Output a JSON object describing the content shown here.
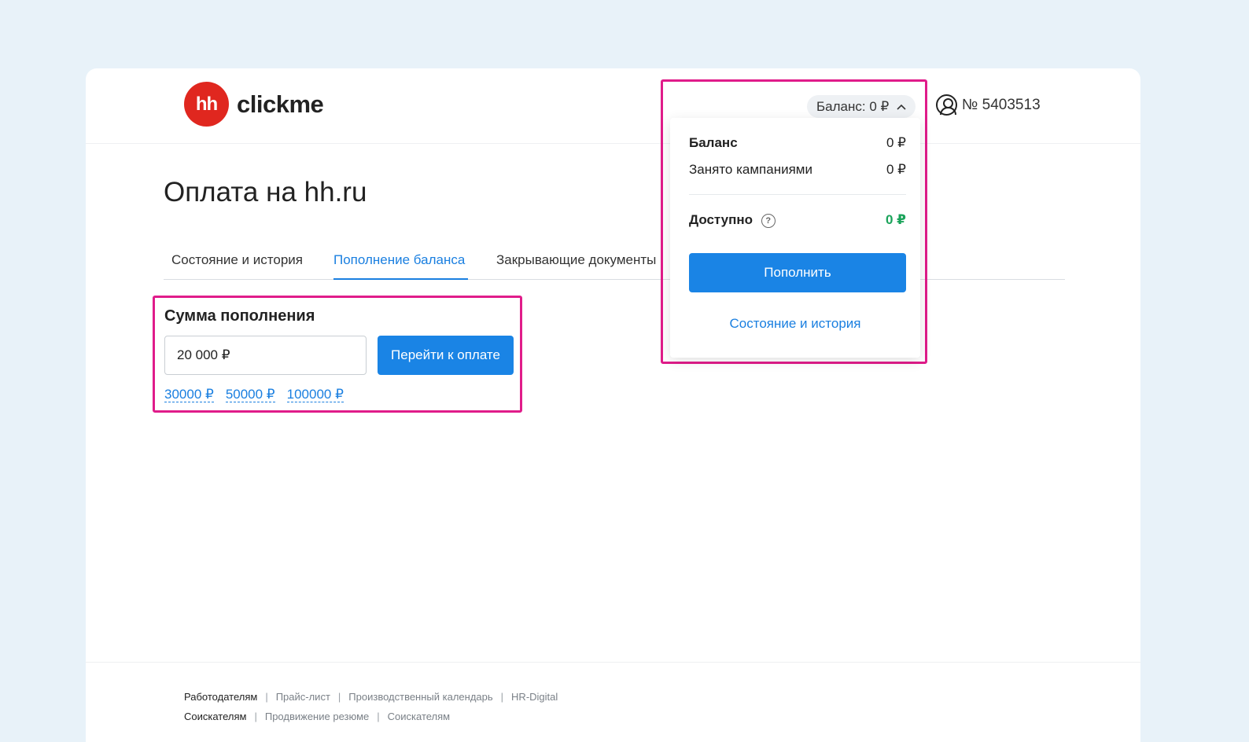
{
  "header": {
    "logo_badge": "hh",
    "logo_text": "clickme",
    "balance_pill": "Баланс: 0 ₽",
    "account_number": "№ 5403513"
  },
  "page": {
    "title": "Оплата на hh.ru"
  },
  "tabs": [
    {
      "label": "Состояние и история",
      "active": false
    },
    {
      "label": "Пополнение баланса",
      "active": true
    },
    {
      "label": "Закрывающие документы",
      "active": false
    }
  ],
  "topup": {
    "title": "Сумма пополнения",
    "amount_value": "20 000 ₽",
    "pay_button": "Перейти к оплате",
    "quick_amounts": [
      "30000 ₽",
      "50000 ₽",
      "100000 ₽"
    ]
  },
  "dropdown": {
    "balance_label": "Баланс",
    "balance_value": "0 ₽",
    "reserved_label": "Занято кампаниями",
    "reserved_value": "0 ₽",
    "available_label": "Доступно",
    "available_value": "0 ₽",
    "help_glyph": "?",
    "topup_button": "Пополнить",
    "history_link": "Состояние и история"
  },
  "footer": {
    "row1": [
      "Работодателям",
      "Прайс-лист",
      "Производственный календарь",
      "HR-Digital"
    ],
    "row2": [
      "Соискателям",
      "Продвижение резюме",
      "Соискателям"
    ]
  },
  "colors": {
    "accent": "#1a84e5",
    "highlight_frame": "#e01c8a",
    "logo_red": "#e0271f",
    "available_green": "#1aa35a"
  }
}
